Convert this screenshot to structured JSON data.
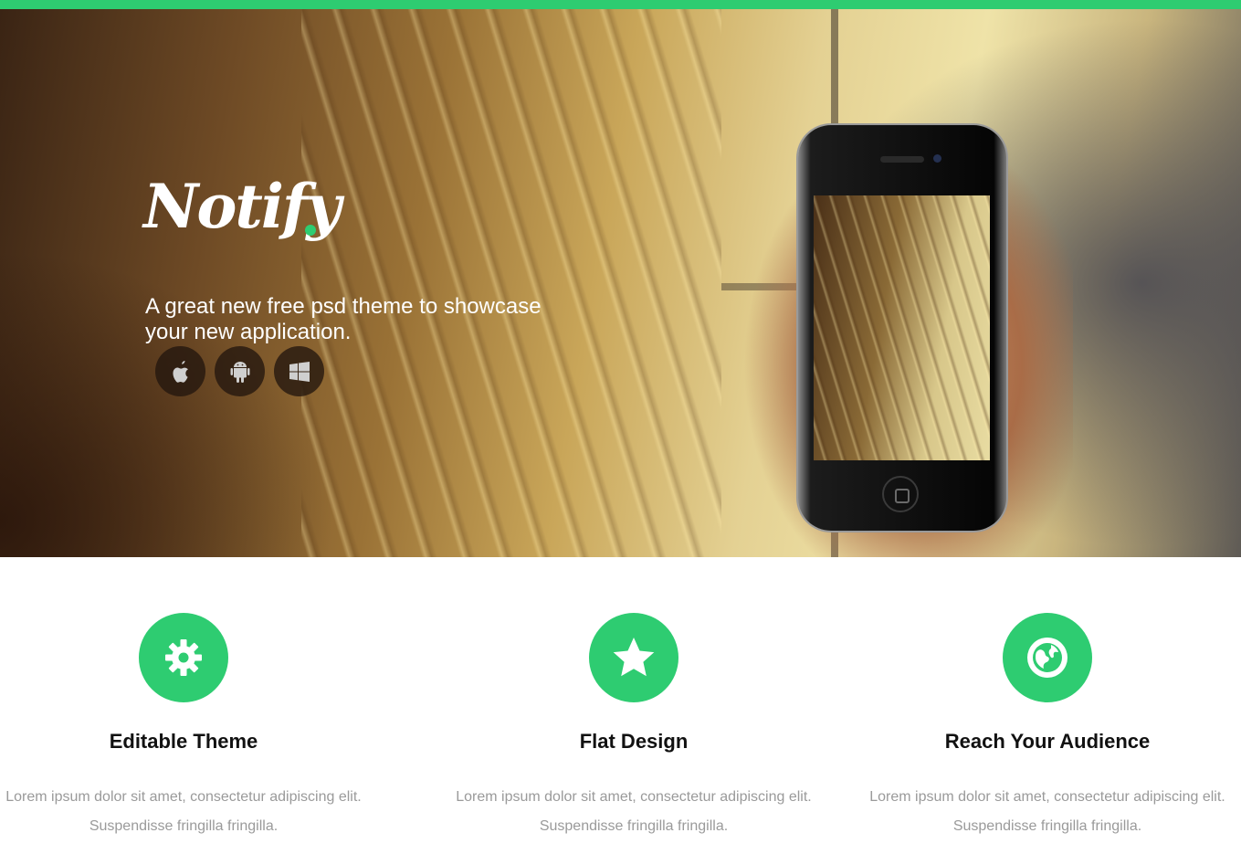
{
  "colors": {
    "accent": "#2ecc71",
    "title": "#111111",
    "body_text": "#9a9a9a"
  },
  "hero": {
    "logo_text": "Notify",
    "tagline": "A great new free psd theme to showcase your new application.",
    "store_buttons": [
      {
        "icon": "apple-icon"
      },
      {
        "icon": "android-icon"
      },
      {
        "icon": "windows-icon"
      }
    ]
  },
  "features": [
    {
      "icon": "gear-icon",
      "title": "Editable Theme",
      "text": "Lorem ipsum dolor sit amet, consectetur adipiscing elit. Suspendisse fringilla fringilla."
    },
    {
      "icon": "star-icon",
      "title": "Flat Design",
      "text": "Lorem ipsum dolor sit amet, consectetur adipiscing elit. Suspendisse fringilla fringilla."
    },
    {
      "icon": "globe-icon",
      "title": "Reach Your Audience",
      "text": "Lorem ipsum dolor sit amet, consectetur adipiscing elit. Suspendisse fringilla fringilla."
    }
  ]
}
